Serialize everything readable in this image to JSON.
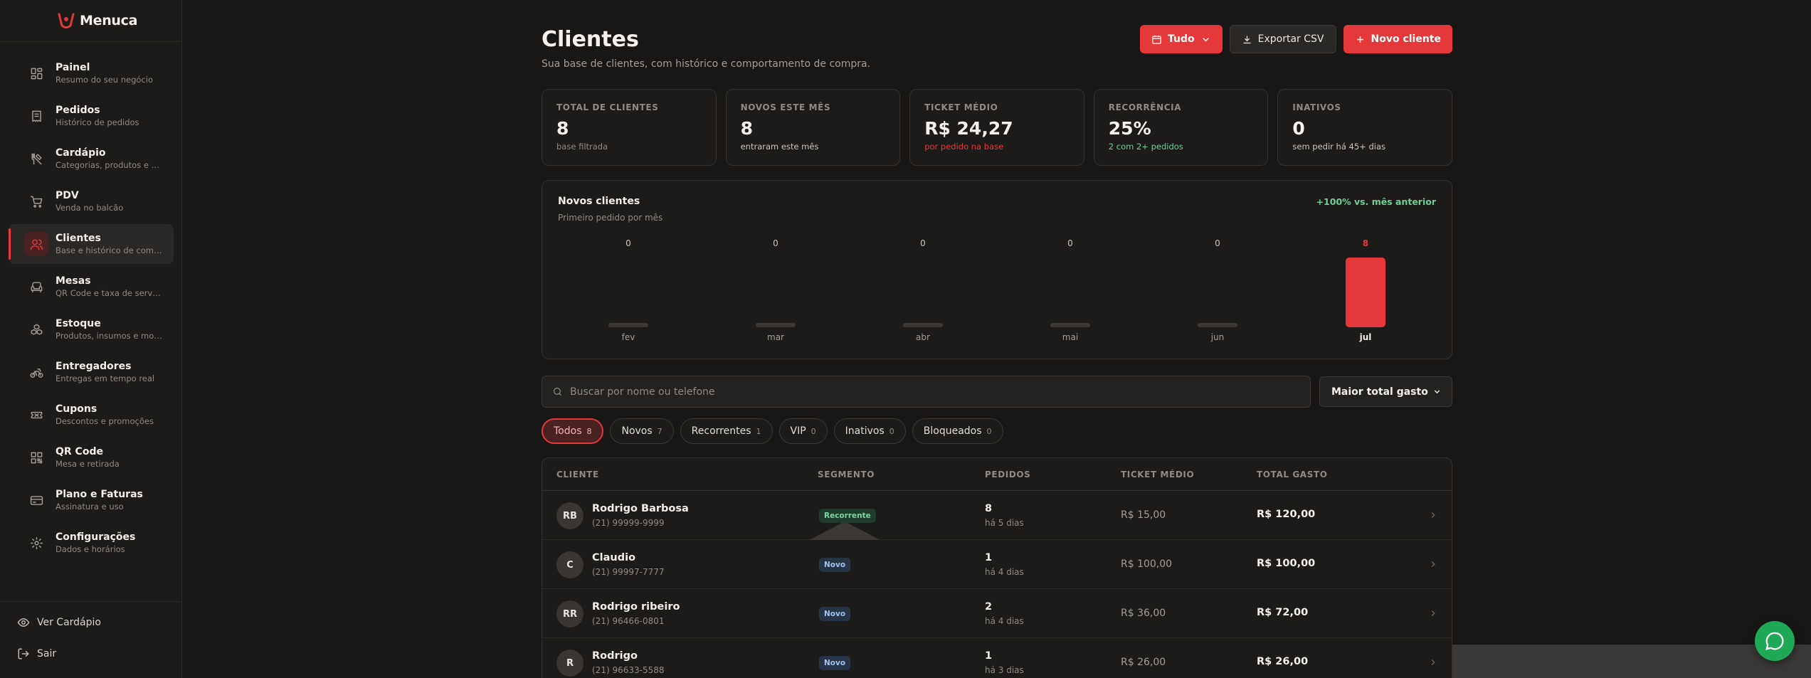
{
  "app": {
    "name": "Menuca"
  },
  "colors": {
    "accent": "#e5383b",
    "success": "#6fcf97",
    "background": "#181716",
    "chat": "#1fa855"
  },
  "sidebar": {
    "items": [
      {
        "label": "Painel",
        "sub": "Resumo do seu negócio",
        "icon": "dashboard-icon"
      },
      {
        "label": "Pedidos",
        "sub": "Histórico de pedidos",
        "icon": "receipt-icon"
      },
      {
        "label": "Cardápio",
        "sub": "Categorias, produtos e adicionais",
        "icon": "utensils-icon"
      },
      {
        "label": "PDV",
        "sub": "Venda no balcão",
        "icon": "cart-icon"
      },
      {
        "label": "Clientes",
        "sub": "Base e histórico de compra",
        "icon": "users-icon",
        "active": true
      },
      {
        "label": "Mesas",
        "sub": "QR Code e taxa de serviço",
        "icon": "armchair-icon"
      },
      {
        "label": "Estoque",
        "sub": "Produtos, insumos e movimentações",
        "icon": "boxes-icon"
      },
      {
        "label": "Entregadores",
        "sub": "Entregas em tempo real",
        "icon": "bike-icon"
      },
      {
        "label": "Cupons",
        "sub": "Descontos e promoções",
        "icon": "ticket-icon"
      },
      {
        "label": "QR Code",
        "sub": "Mesa e retirada",
        "icon": "qr-icon"
      },
      {
        "label": "Plano e Faturas",
        "sub": "Assinatura e uso",
        "icon": "credit-card-icon"
      },
      {
        "label": "Configurações",
        "sub": "Dados e horários",
        "icon": "gear-icon"
      }
    ],
    "footer": {
      "view_menu": "Ver Cardápio",
      "logout": "Sair"
    }
  },
  "header": {
    "title": "Clientes",
    "subtitle": "Sua base de clientes, com histórico e comportamento de compra.",
    "period_button": "Tudo",
    "export_button": "Exportar CSV",
    "new_button": "Novo cliente"
  },
  "stats": [
    {
      "label": "TOTAL DE CLIENTES",
      "value": "8",
      "note": "base filtrada",
      "tone": "muted"
    },
    {
      "label": "NOVOS ESTE MÊS",
      "value": "8",
      "note": "entraram este mês",
      "tone": "light"
    },
    {
      "label": "TICKET MÉDIO",
      "value": "R$ 24,27",
      "note": "por pedido na base",
      "tone": "red"
    },
    {
      "label": "RECORRÊNCIA",
      "value": "25%",
      "note": "2 com 2+ pedidos",
      "tone": "green"
    },
    {
      "label": "INATIVOS",
      "value": "0",
      "note": "sem pedir há 45+ dias",
      "tone": "light"
    }
  ],
  "chart_panel": {
    "title": "Novos clientes",
    "subtitle": "Primeiro pedido por mês",
    "badge": "+100% vs. mês anterior"
  },
  "chart_data": {
    "type": "bar",
    "categories": [
      "fev",
      "mar",
      "abr",
      "mai",
      "jun",
      "jul"
    ],
    "values": [
      0,
      0,
      0,
      0,
      0,
      8
    ],
    "highlight_index": 5,
    "ylim": [
      0,
      8
    ],
    "grid": false
  },
  "search": {
    "placeholder": "Buscar por nome ou telefone"
  },
  "sort": {
    "selected": "Maior total gasto"
  },
  "filters": [
    {
      "label": "Todos",
      "count": "8",
      "active": true
    },
    {
      "label": "Novos",
      "count": "7"
    },
    {
      "label": "Recorrentes",
      "count": "1"
    },
    {
      "label": "VIP",
      "count": "0"
    },
    {
      "label": "Inativos",
      "count": "0"
    },
    {
      "label": "Bloqueados",
      "count": "0"
    }
  ],
  "table": {
    "headers": {
      "client": "CLIENTE",
      "segment": "SEGMENTO",
      "orders": "PEDIDOS",
      "ticket": "TICKET MÉDIO",
      "total": "TOTAL GASTO"
    },
    "rows": [
      {
        "initials": "RB",
        "name": "Rodrigo Barbosa",
        "phone": "(21) 99999-9999",
        "segment": "Recorrente",
        "segment_type": "rec",
        "orders": "8",
        "when": "há 5 dias",
        "ticket": "R$ 15,00",
        "total": "R$ 120,00"
      },
      {
        "initials": "C",
        "name": "Claudio",
        "phone": "(21) 99997-7777",
        "segment": "Novo",
        "segment_type": "novo",
        "orders": "1",
        "when": "há 4 dias",
        "ticket": "R$ 100,00",
        "total": "R$ 100,00"
      },
      {
        "initials": "RR",
        "name": "Rodrigo ribeiro",
        "phone": "(21) 96466-0801",
        "segment": "Novo",
        "segment_type": "novo",
        "orders": "2",
        "when": "há 4 dias",
        "ticket": "R$ 36,00",
        "total": "R$ 72,00"
      },
      {
        "initials": "R",
        "name": "Rodrigo",
        "phone": "(21) 96633-5588",
        "segment": "Novo",
        "segment_type": "novo",
        "orders": "1",
        "when": "há 3 dias",
        "ticket": "R$ 26,00",
        "total": "R$ 26,00"
      }
    ]
  }
}
